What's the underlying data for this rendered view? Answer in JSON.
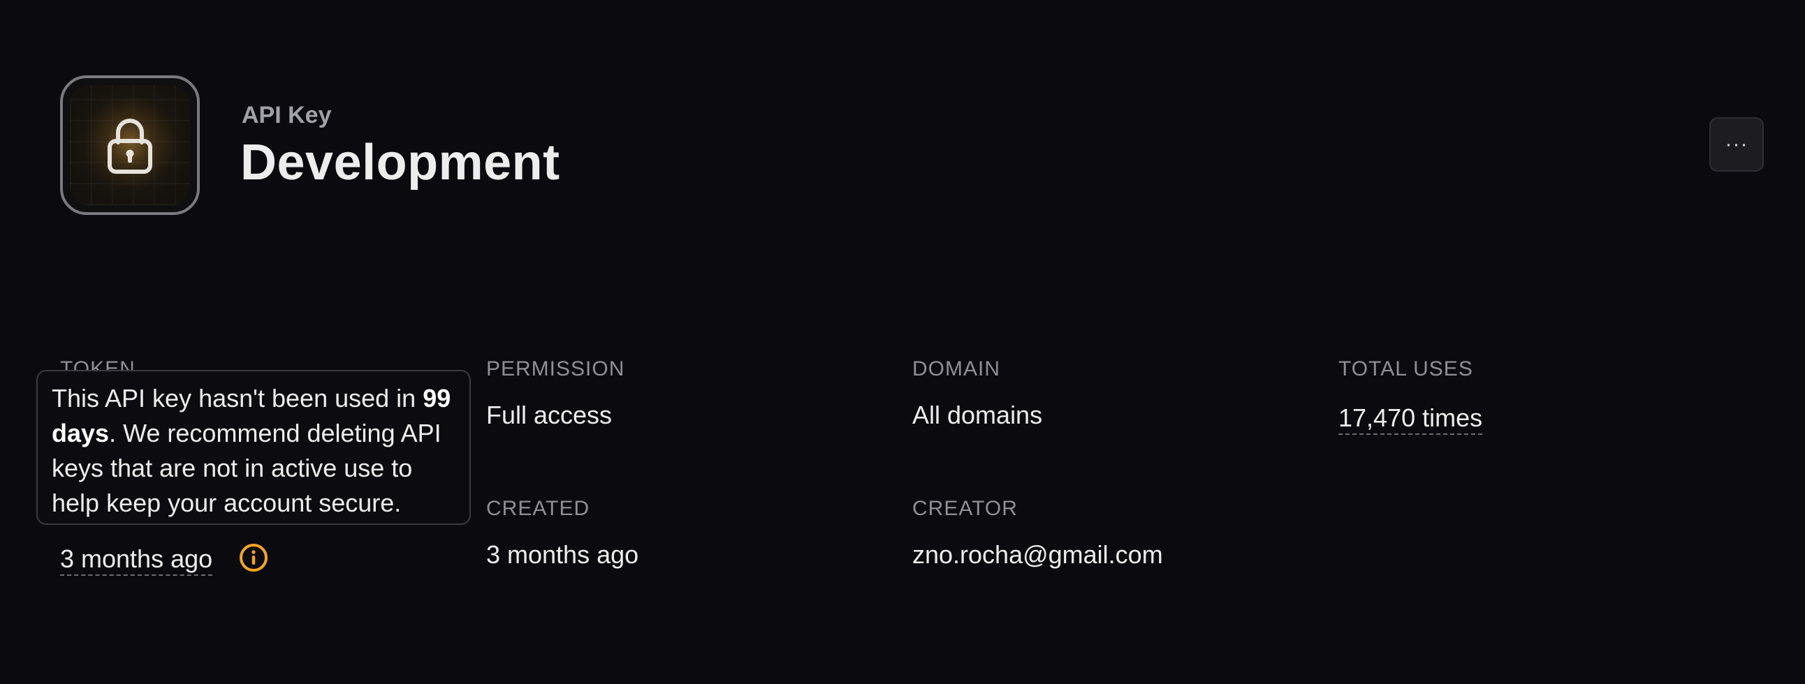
{
  "header": {
    "eyebrow": "API Key",
    "title": "Development",
    "more_label": "···"
  },
  "details": {
    "token": {
      "label": "TOKEN",
      "value": "3 months ago"
    },
    "permission": {
      "label": "PERMISSION",
      "value": "Full access"
    },
    "domain": {
      "label": "DOMAIN",
      "value": "All domains"
    },
    "total_uses": {
      "label": "TOTAL USES",
      "value": "17,470 times"
    },
    "created": {
      "label": "CREATED",
      "value": "3 months ago"
    },
    "creator": {
      "label": "CREATOR",
      "value": "zno.rocha@gmail.com"
    }
  },
  "tooltip": {
    "text_before": "This API key hasn't been used in ",
    "highlight": "99 days",
    "text_after": ". We recommend deleting API keys that are not in active use to help keep your account secure."
  },
  "icons": {
    "app_icon": "lock-icon",
    "more": "ellipsis-icon",
    "warning": "info-icon"
  },
  "colors": {
    "background": "#0b0b0f",
    "warning": "#f5a524",
    "text_primary": "#ededed",
    "text_muted": "#8f8f96"
  }
}
